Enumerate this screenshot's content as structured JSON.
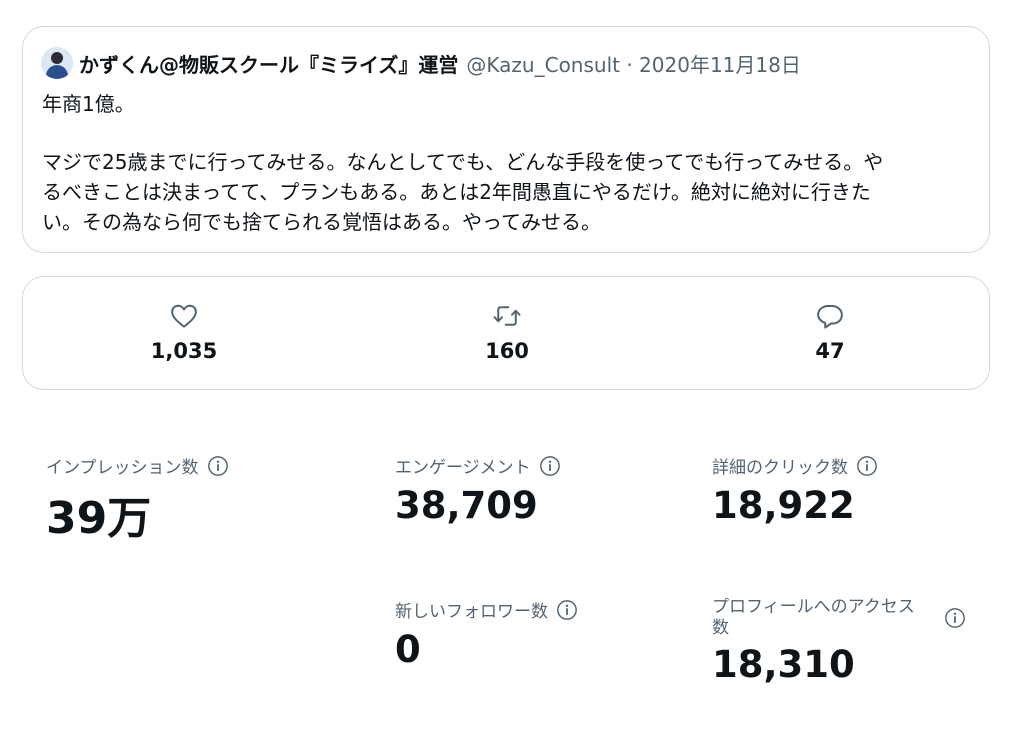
{
  "tweet": {
    "display_name": "かずくん@物販スクール『ミライズ』運営",
    "handle_and_date": "@Kazu_Consult · 2020年11月18日",
    "text_line1": "年商1億。",
    "text_line2": "マジで25歳までに行ってみせる。なんとしてでも、どんな手段を使ってでも行ってみせる。や",
    "text_line3": "るべきことは決まってて、プランもある。あとは2年間愚直にやるだけ。絶対に絶対に行きた",
    "text_line4": "い。その為なら何でも捨てられる覚悟はある。やってみせる。"
  },
  "actions": {
    "likes": {
      "icon": "heart-icon",
      "count": "1,035"
    },
    "retweets": {
      "icon": "retweet-icon",
      "count": "160"
    },
    "replies": {
      "icon": "reply-icon",
      "count": "47"
    }
  },
  "metrics": {
    "impressions": {
      "label": "インプレッション数",
      "value": "39万"
    },
    "engagements": {
      "label": "エンゲージメント",
      "value": "38,709"
    },
    "detail_clicks": {
      "label": "詳細のクリック数",
      "value": "18,922"
    },
    "new_followers": {
      "label": "新しいフォロワー数",
      "value": "0"
    },
    "profile_visits": {
      "label": "プロフィールへのアクセス数",
      "value": "18,310"
    }
  },
  "colors": {
    "text_primary": "#0f1419",
    "text_secondary": "#536471",
    "border": "#cfd9de"
  }
}
